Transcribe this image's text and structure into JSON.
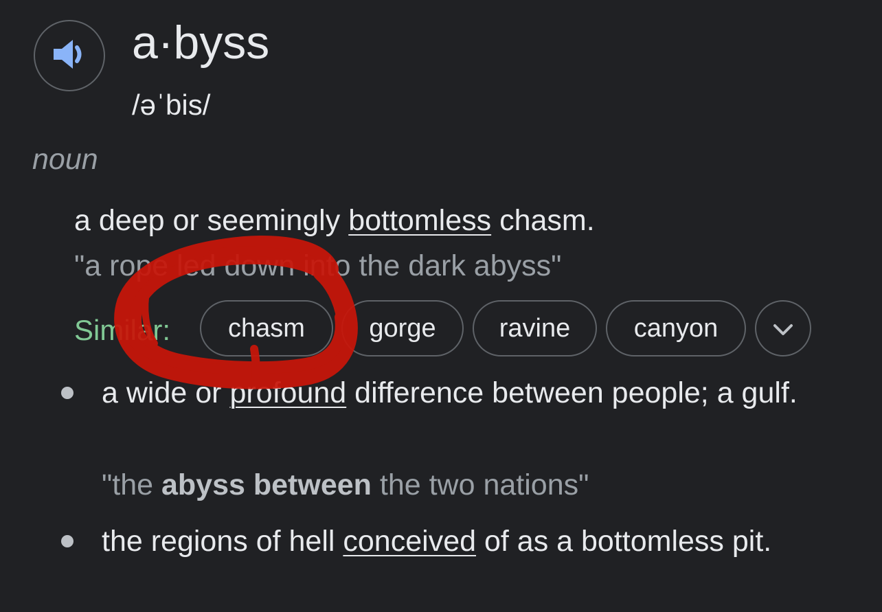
{
  "entry": {
    "headword": "a·byss",
    "phonetic": "/əˈbis/",
    "part_of_speech": "noun",
    "speaker_icon": "speaker-icon"
  },
  "sense1": {
    "definition_before": "a deep or seemingly ",
    "definition_link": "bottomless",
    "definition_after": " chasm.",
    "example": "\"a rope led down into the dark abyss\""
  },
  "similar": {
    "label": "Similar:",
    "chips": [
      "chasm",
      "gorge",
      "ravine",
      "canyon"
    ],
    "more_icon": "chevron-down-icon"
  },
  "sense2": {
    "definition_before": "a wide or ",
    "definition_link": "profound",
    "definition_after": " difference between people; a gulf.",
    "example_open": "\"the ",
    "example_bold": "abyss between",
    "example_close": " the two nations\""
  },
  "sense3": {
    "definition_before": "the regions of hell ",
    "definition_link": "conceived",
    "definition_after": " of as a bottomless pit."
  },
  "colors": {
    "background": "#202124",
    "text": "#e8eaed",
    "muted": "#9aa0a6",
    "similar_label": "#81c995",
    "speaker_icon": "#8ab4f8",
    "annotation_scribble": "#c8160a"
  }
}
